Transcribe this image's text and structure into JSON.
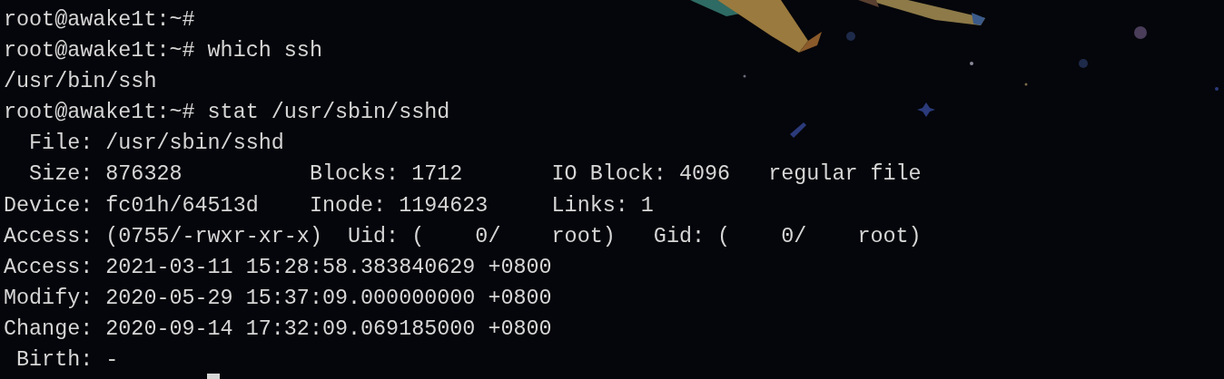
{
  "terminal": {
    "lines": [
      "root@awake1t:~#",
      "root@awake1t:~# which ssh",
      "/usr/bin/ssh",
      "root@awake1t:~# stat /usr/sbin/sshd",
      "  File: /usr/sbin/sshd",
      "  Size: 876328          Blocks: 1712       IO Block: 4096   regular file",
      "Device: fc01h/64513d    Inode: 1194623     Links: 1",
      "Access: (0755/-rwxr-xr-x)  Uid: (    0/    root)   Gid: (    0/    root)",
      "Access: 2021-03-11 15:28:58.383840629 +0800",
      "Modify: 2020-05-29 15:37:09.000000000 +0800",
      "Change: 2020-09-14 17:32:09.069185000 +0800",
      " Birth: -"
    ]
  }
}
